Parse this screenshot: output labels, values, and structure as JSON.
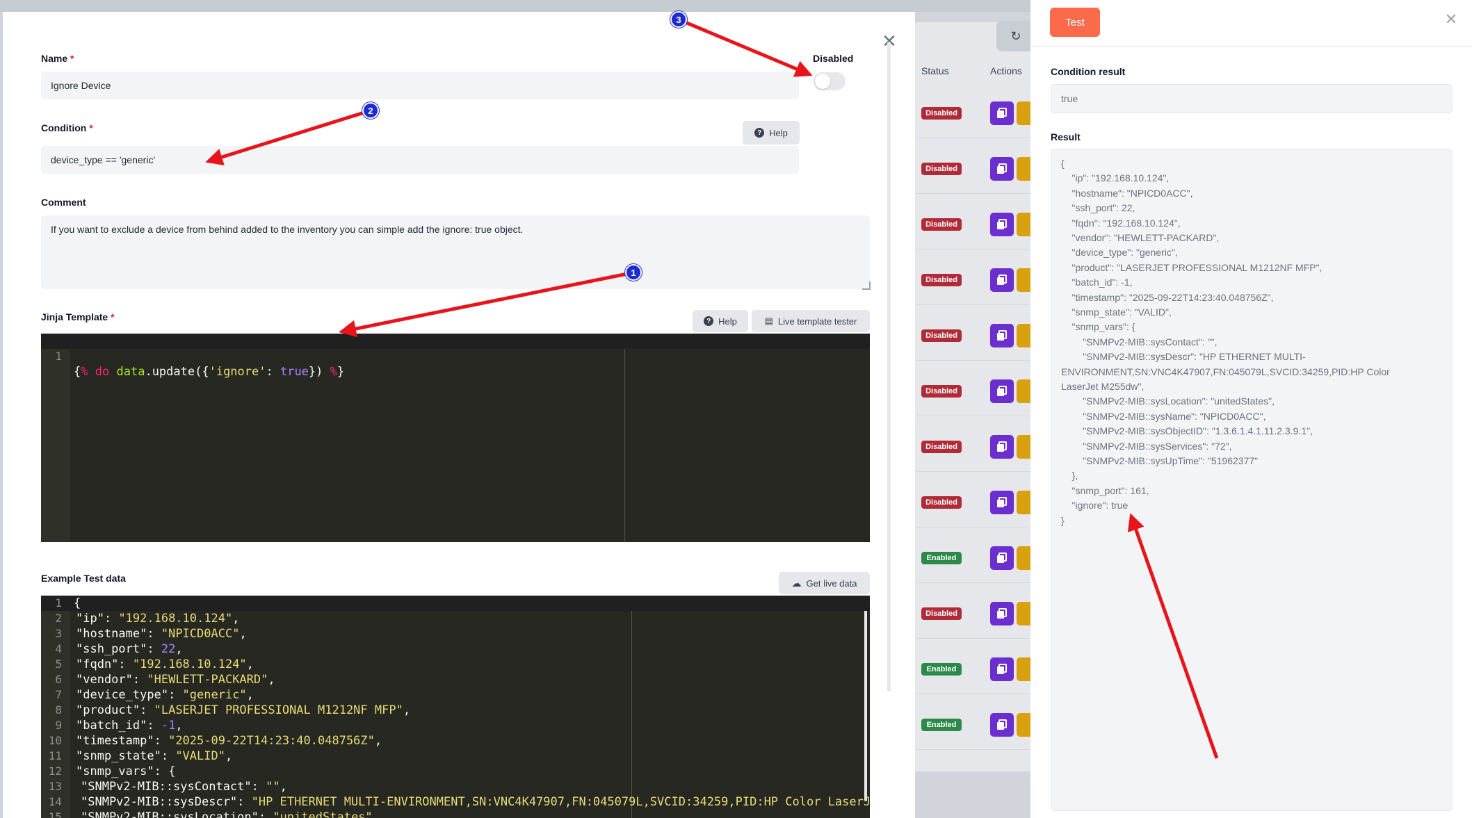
{
  "modal": {
    "name_label": "Name",
    "name_value": "Ignore Device",
    "required_mark": "*",
    "disabled_label": "Disabled",
    "condition_label": "Condition",
    "condition_value": "device_type == 'generic'",
    "help_label": "Help",
    "comment_label": "Comment",
    "comment_value": "If you want to exclude a device from behind added to the inventory you can simple add the ignore: true object.",
    "template_label": "Jinja Template",
    "template_help_label": "Help",
    "live_tester_label": "Live template tester",
    "template_code": {
      "line_no": "1",
      "open": "{%",
      "kw_do": "do",
      "var": "data",
      "dot": ".",
      "fn": "update",
      "paren_open": "({",
      "str": "'ignore'",
      "colon": ": ",
      "kw_true": "true",
      "paren_close": "})",
      "close": "%",
      "brace": "}"
    },
    "example_label": "Example Test data",
    "get_live_label": "Get live data",
    "example_lines": [
      {
        "n": "1",
        "text": "{"
      },
      {
        "n": "2",
        "k": "\"ip\"",
        "v": "\"192.168.10.124\""
      },
      {
        "n": "3",
        "k": "\"hostname\"",
        "v": "\"NPICD0ACC\""
      },
      {
        "n": "4",
        "k": "\"ssh_port\"",
        "num": "22"
      },
      {
        "n": "5",
        "k": "\"fqdn\"",
        "v": "\"192.168.10.124\""
      },
      {
        "n": "6",
        "k": "\"vendor\"",
        "v": "\"HEWLETT-PACKARD\""
      },
      {
        "n": "7",
        "k": "\"device_type\"",
        "v": "\"generic\""
      },
      {
        "n": "8",
        "k": "\"product\"",
        "v": "\"LASERJET PROFESSIONAL M1212NF MFP\""
      },
      {
        "n": "9",
        "k": "\"batch_id\"",
        "num": "-1"
      },
      {
        "n": "10",
        "k": "\"timestamp\"",
        "v": "\"2025-09-22T14:23:40.048756Z\""
      },
      {
        "n": "11",
        "k": "\"snmp_state\"",
        "v": "\"VALID\""
      },
      {
        "n": "12",
        "k": "\"snmp_vars\"",
        "text2": "{"
      },
      {
        "n": "13",
        "k": "\"SNMPv2-MIB::sysContact\"",
        "v": "\"\"",
        "deep": true
      },
      {
        "n": "14",
        "k": "\"SNMPv2-MIB::sysDescr\"",
        "v": "\"HP ETHERNET MULTI-ENVIRONMENT,SN:VNC4K47907,FN:045079L,SVCID:34259,PID:HP Color LaserJ",
        "deep": true,
        "nocomma": true
      },
      {
        "n": "15",
        "k": "\"SNMPv2-MIB::sysLocation\"",
        "v": "\"unitedStates\"",
        "deep": true
      }
    ]
  },
  "table": {
    "status_header": "Status",
    "actions_header": "Actions",
    "rows": [
      {
        "status": "Disabled"
      },
      {
        "status": "Disabled"
      },
      {
        "status": "Disabled"
      },
      {
        "status": "Disabled"
      },
      {
        "status": "Disabled"
      },
      {
        "status": "Disabled"
      },
      {
        "status": "Disabled"
      },
      {
        "status": "Disabled"
      },
      {
        "status": "Enabled"
      },
      {
        "status": "Disabled"
      },
      {
        "status": "Enabled"
      },
      {
        "status": "Enabled"
      }
    ]
  },
  "side": {
    "test_label": "Test",
    "condition_result_label": "Condition result",
    "condition_result_value": "true",
    "result_label": "Result",
    "result_lines": [
      "{",
      "    \"ip\": \"192.168.10.124\",",
      "    \"hostname\": \"NPICD0ACC\",",
      "    \"ssh_port\": 22,",
      "    \"fqdn\": \"192.168.10.124\",",
      "    \"vendor\": \"HEWLETT-PACKARD\",",
      "    \"device_type\": \"generic\",",
      "    \"product\": \"LASERJET PROFESSIONAL M1212NF MFP\",",
      "    \"batch_id\": -1,",
      "    \"timestamp\": \"2025-09-22T14:23:40.048756Z\",",
      "    \"snmp_state\": \"VALID\",",
      "    \"snmp_vars\": {",
      "        \"SNMPv2-MIB::sysContact\": \"\",",
      "        \"SNMPv2-MIB::sysDescr\": \"HP ETHERNET MULTI-",
      "ENVIRONMENT,SN:VNC4K47907,FN:045079L,SVCID:34259,PID:HP Color",
      "LaserJet M255dw\",",
      "        \"SNMPv2-MIB::sysLocation\": \"unitedStates\",",
      "        \"SNMPv2-MIB::sysName\": \"NPICD0ACC\",",
      "        \"SNMPv2-MIB::sysObjectID\": \"1.3.6.1.4.1.11.2.3.9.1\",",
      "        \"SNMPv2-MIB::sysServices\": \"72\",",
      "        \"SNMPv2-MIB::sysUpTime\": \"51962377\"",
      "    },",
      "    \"snmp_port\": 161,",
      "    \"ignore\": true",
      "}"
    ]
  },
  "annotations": {
    "markers": [
      "1",
      "2",
      "3"
    ],
    "arrow_color": "#e8141b"
  },
  "colors": {
    "accent": "#fb6a4a",
    "badge_disabled": "#b02a37",
    "badge_enabled": "#2b8a4a",
    "editor_bg": "#272822"
  }
}
